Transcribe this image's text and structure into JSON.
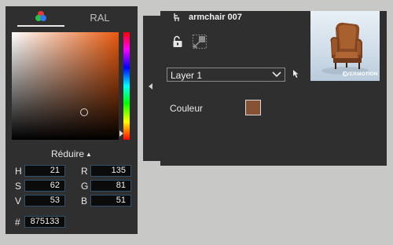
{
  "picker": {
    "tabs": [
      {
        "id": "rgb",
        "icon": "rgb-dots-icon",
        "active": true
      },
      {
        "id": "ral",
        "label": "RAL",
        "active": false
      }
    ],
    "gradient_base_color": "#e85a0f",
    "reduce_label": "Réduire",
    "fields": {
      "H": {
        "label": "H",
        "value": "21"
      },
      "S": {
        "label": "S",
        "value": "62"
      },
      "V": {
        "label": "V",
        "value": "53"
      },
      "R": {
        "label": "R",
        "value": "135"
      },
      "G": {
        "label": "G",
        "value": "81"
      },
      "B": {
        "label": "B",
        "value": "51"
      }
    },
    "hex": {
      "label": "#",
      "value": "875133"
    }
  },
  "object": {
    "name": "armchair 007",
    "layer": {
      "selected": "Layer 1"
    },
    "color": {
      "label": "Couleur",
      "value": "#875133"
    },
    "thumbnail_brand": "EVERMOTION"
  },
  "colors": {
    "panel_bg": "#2f2f2f",
    "page_bg": "#c8c8c6",
    "input_border": "#31506b"
  }
}
